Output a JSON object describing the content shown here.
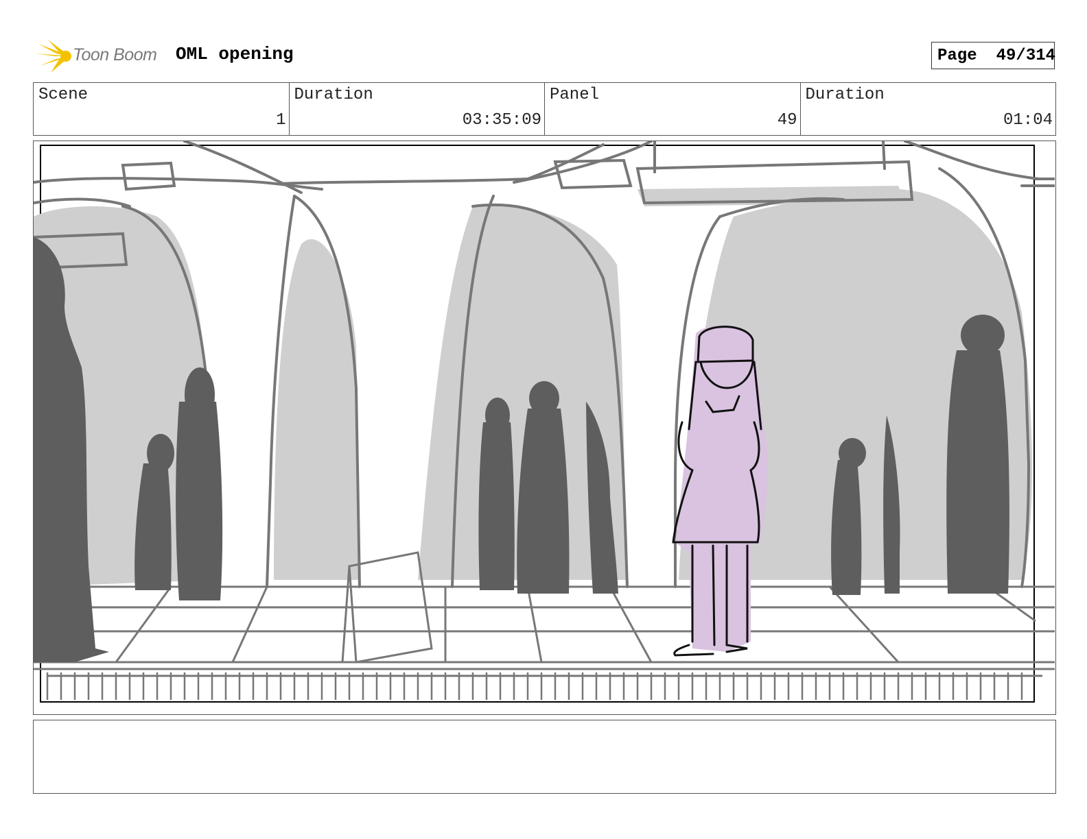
{
  "header": {
    "logo_text": "Toon Boom",
    "project_title": "OML opening",
    "page_label": "Page",
    "page_number": "49/314"
  },
  "info": {
    "scene_label": "Scene",
    "scene_value": "1",
    "scene_duration_label": "Duration",
    "scene_duration_value": "03:35:09",
    "panel_label": "Panel",
    "panel_value": "49",
    "panel_duration_label": "Duration",
    "panel_duration_value": "01:04"
  },
  "notes": {
    "text": ""
  },
  "colors": {
    "sketch_gray": "#777777",
    "arch_fill": "#cfcfcf",
    "silhouette": "#5e5e5e",
    "character_fill": "#d9c3e0",
    "logo_yellow": "#f2c200"
  }
}
